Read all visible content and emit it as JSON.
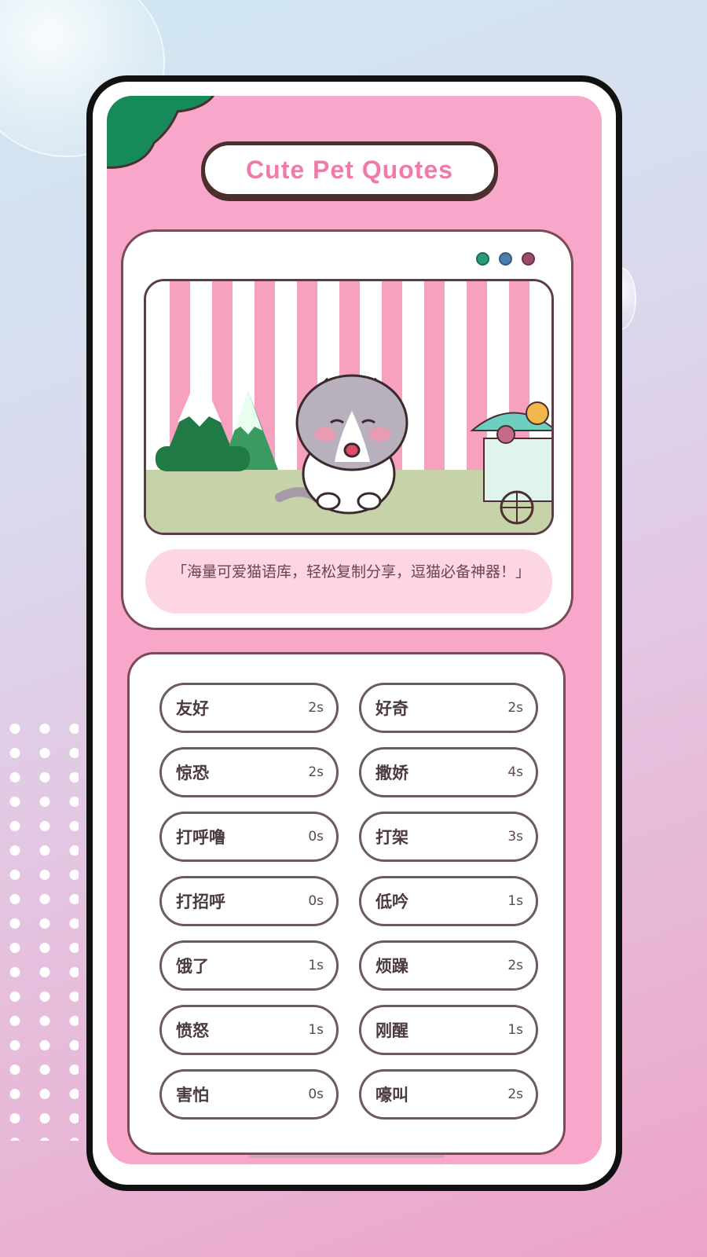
{
  "app": {
    "title": "Cute Pet Quotes"
  },
  "colors": {
    "accent": "#f07aa9",
    "card_bg": "#f8a7cb",
    "outline": "#4b2e2e"
  },
  "window_dots": [
    {
      "color": "#2a9a7c"
    },
    {
      "color": "#4a7fb0"
    },
    {
      "color": "#9a4a6a"
    }
  ],
  "caption": "「海量可爱猫语库，轻松复制分享，逗猫必备神器！」",
  "sounds": [
    {
      "name": "友好",
      "duration": "2s"
    },
    {
      "name": "好奇",
      "duration": "2s"
    },
    {
      "name": "惊恐",
      "duration": "2s"
    },
    {
      "name": "撒娇",
      "duration": "4s"
    },
    {
      "name": "打呼噜",
      "duration": "0s"
    },
    {
      "name": "打架",
      "duration": "3s"
    },
    {
      "name": "打招呼",
      "duration": "0s"
    },
    {
      "name": "低吟",
      "duration": "1s"
    },
    {
      "name": "饿了",
      "duration": "1s"
    },
    {
      "name": "烦躁",
      "duration": "2s"
    },
    {
      "name": "愤怒",
      "duration": "1s"
    },
    {
      "name": "刚醒",
      "duration": "1s"
    },
    {
      "name": "害怕",
      "duration": "0s"
    },
    {
      "name": "嚎叫",
      "duration": "2s"
    }
  ]
}
